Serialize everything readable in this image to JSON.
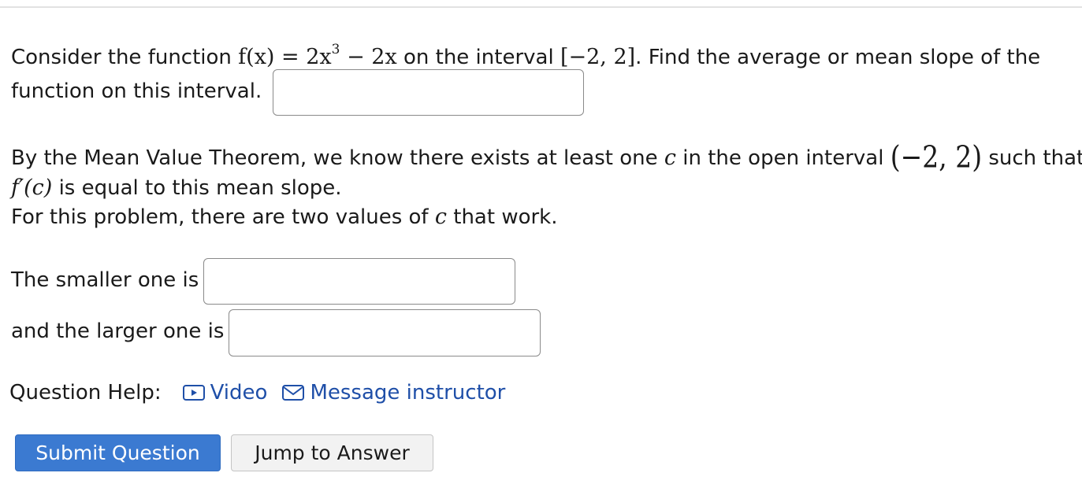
{
  "question": {
    "p1_text_a": "Consider the function",
    "p1_func_lhs": "f(x) = 2x",
    "p1_func_exp": "3",
    "p1_func_rhs": "− 2x",
    "p1_text_b": "on the interval",
    "p1_interval": "[−2, 2]",
    "p1_text_c": ". Find the average or mean slope of the",
    "p1_line2": "function on this interval.",
    "p2_text_a": "By the Mean Value Theorem, we know there exists at least one",
    "p2_var_c": "c",
    "p2_text_b": "in the open interval",
    "p2_open_interval": "(−2, 2)",
    "p2_text_c": "such that",
    "p2_fprime": "f′(c)",
    "p2_text_d": "is equal to this mean slope.",
    "p3_text_a": "For this problem, there are two values of",
    "p3_var_c": "c",
    "p3_text_b": "that work.",
    "smaller_label": "The smaller one is",
    "larger_label": "and the larger one is"
  },
  "inputs": {
    "mean_slope_value": "",
    "smaller_value": "",
    "larger_value": ""
  },
  "help": {
    "label": "Question Help:",
    "video_label": "Video",
    "message_label": "Message instructor"
  },
  "buttons": {
    "submit_label": "Submit Question",
    "jump_label": "Jump to Answer"
  },
  "colors": {
    "link": "#1f4fa8",
    "primary_button": "#3b7ad1"
  }
}
